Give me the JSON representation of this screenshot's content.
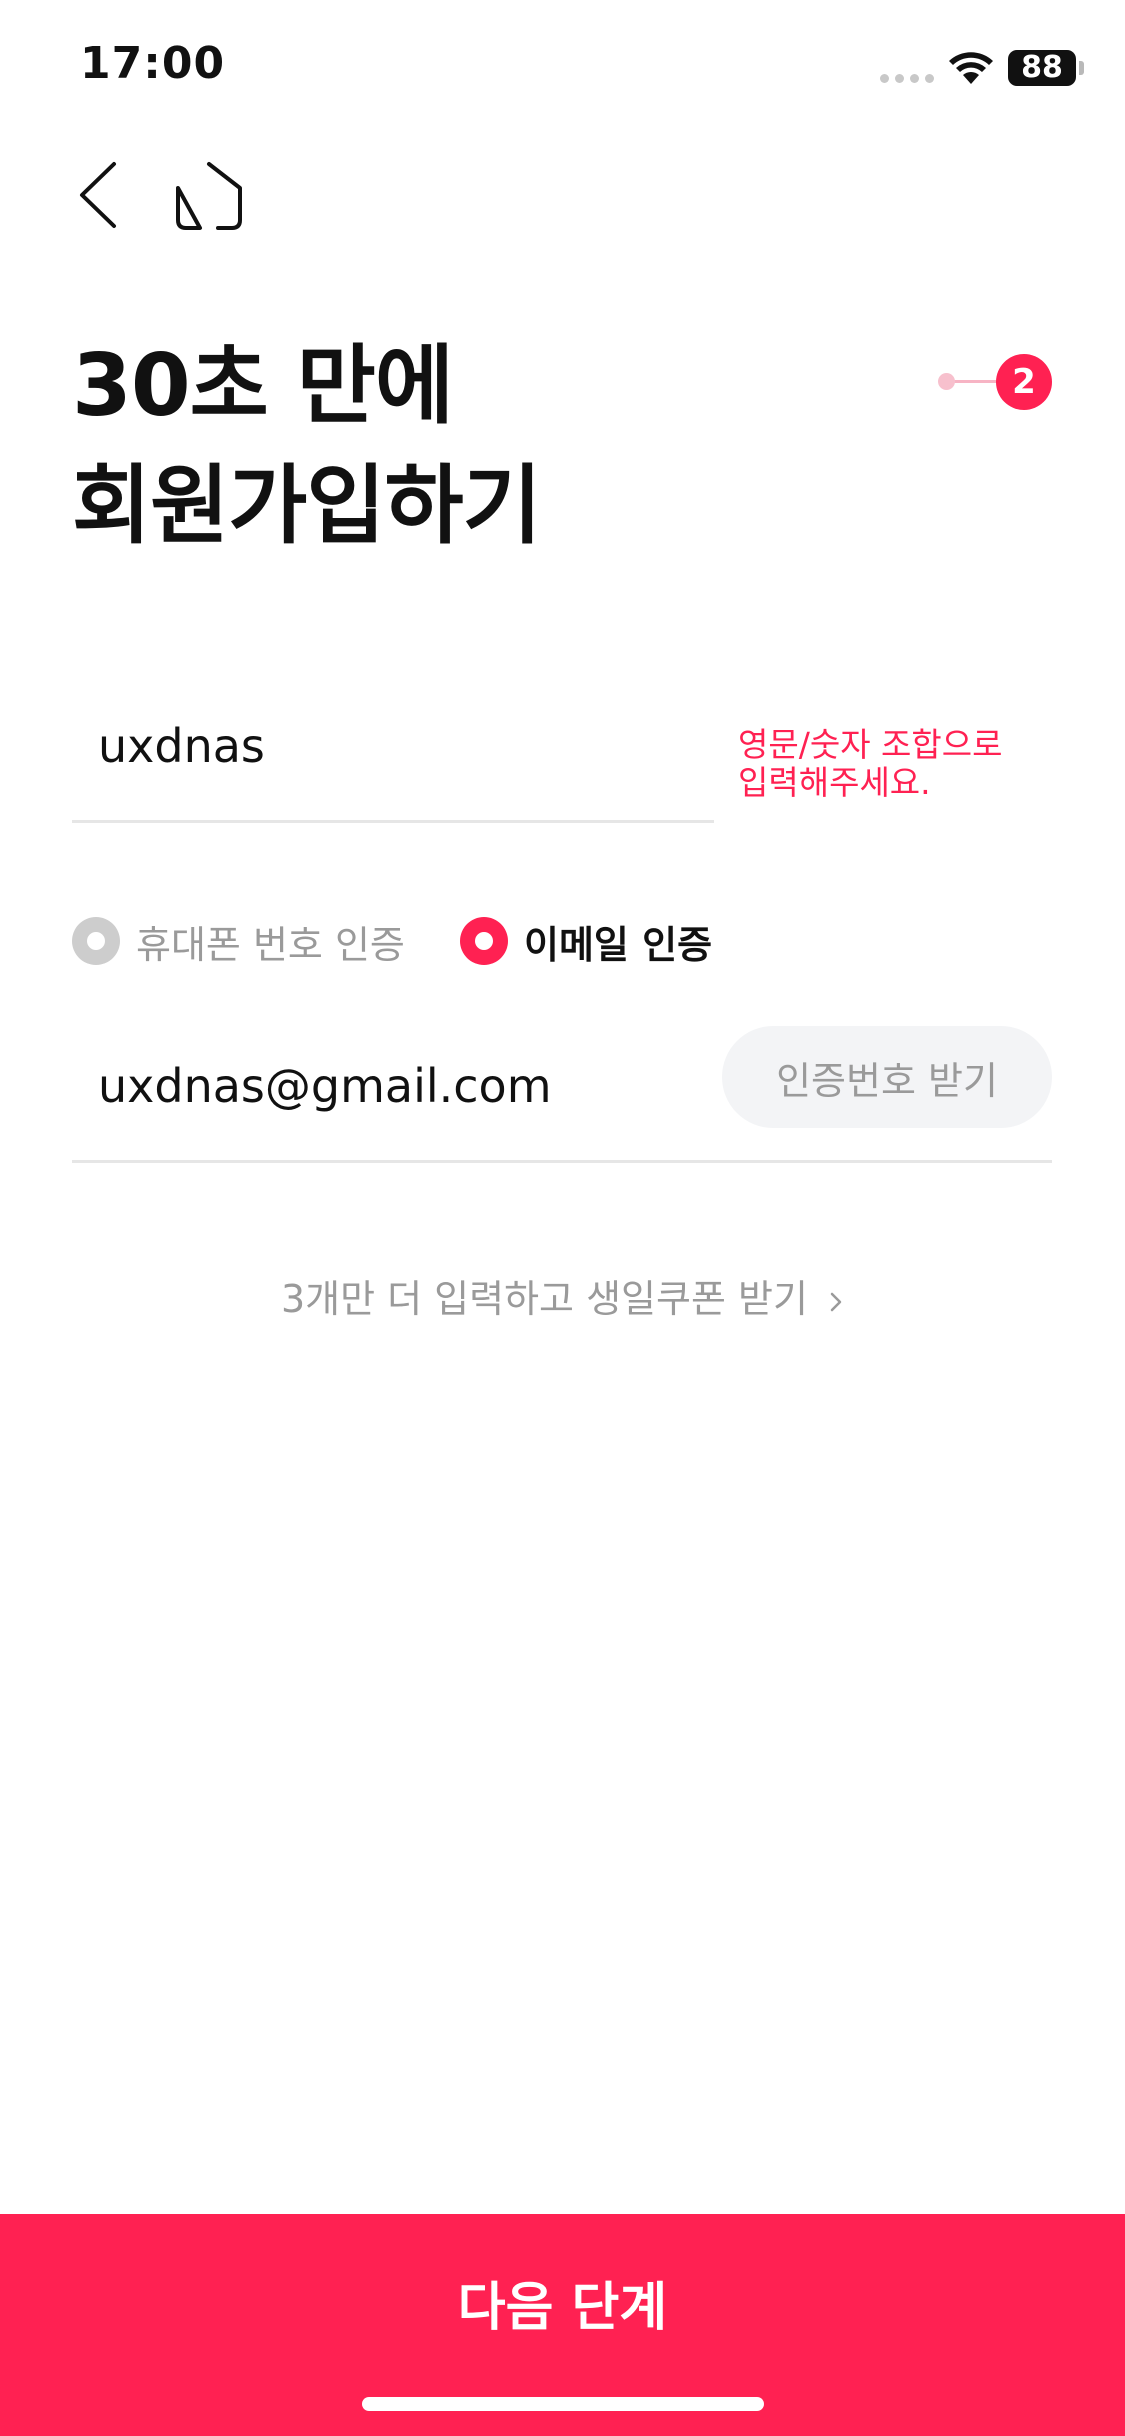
{
  "status_bar": {
    "time": "17:00",
    "battery": "88"
  },
  "nav": {
    "back_icon": "chevron-left-icon",
    "home_icon": "home-icon"
  },
  "title": "30초 만에\n회원가입하기",
  "step": {
    "current": "2"
  },
  "id_field": {
    "value": "uxdnas",
    "hint": "영문/숫자 조합으로\n입력해주세요."
  },
  "verification": {
    "phone_label": "휴대폰 번호 인증",
    "email_label": "이메일 인증",
    "selected": "email"
  },
  "email_field": {
    "value": "uxdnas@gmail.com",
    "button_label": "인증번호 받기"
  },
  "coupon_link": "3개만 더 입력하고 생일쿠폰 받기",
  "next_button": "다음 단계",
  "colors": {
    "accent": "#ff2152",
    "muted_text": "#9a9a9a",
    "divider": "#e6e6e6",
    "button_bg": "#f3f4f6"
  }
}
